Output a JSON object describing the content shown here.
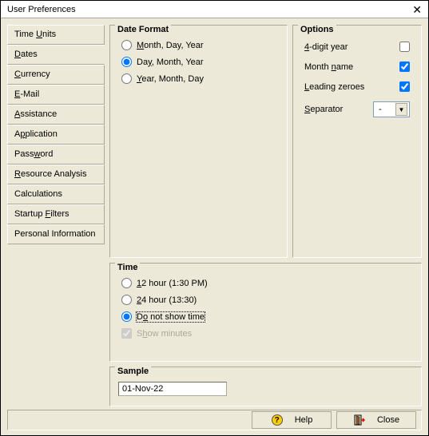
{
  "window": {
    "title": "User Preferences"
  },
  "sidebar": {
    "items": [
      {
        "html": "Time <span class='u'>U</span>nits"
      },
      {
        "html": "<span class='u'>D</span>ates"
      },
      {
        "html": "<span class='u'>C</span>urrency"
      },
      {
        "html": "<span class='u'>E</span>-Mail"
      },
      {
        "html": "<span class='u'>A</span>ssistance"
      },
      {
        "html": "A<span class='u'>p</span>plication"
      },
      {
        "html": "Pass<span class='u'>w</span>ord"
      },
      {
        "html": "<span class='u'>R</span>esource Analysis"
      },
      {
        "html": "Calculations"
      },
      {
        "html": "Startup <span class='u'>F</span>ilters"
      },
      {
        "html": "Personal Information"
      }
    ],
    "active_index": 1
  },
  "dateformat": {
    "title": "Date Format",
    "options": [
      {
        "html": "<span class='u'>M</span>onth, Day, Year",
        "checked": false
      },
      {
        "html": "Da<span class='u'>y</span>, Month, Year",
        "checked": true
      },
      {
        "html": "<span class='u'>Y</span>ear, Month, Day",
        "checked": false
      }
    ]
  },
  "options": {
    "title": "Options",
    "checks": [
      {
        "html": "<span class='u'>4</span>-digit year",
        "checked": false
      },
      {
        "html": "Month <span class='u'>n</span>ame",
        "checked": true
      },
      {
        "html": "<span class='u'>L</span>eading zeroes",
        "checked": true
      }
    ],
    "separator": {
      "html": "<span class='u'>S</span>eparator",
      "value": "-"
    }
  },
  "time": {
    "title": "Time",
    "radios": [
      {
        "html": "<span class='u'>1</span>2 hour (1:30 PM)",
        "checked": false
      },
      {
        "html": "<span class='u'>2</span>4 hour (13:30)",
        "checked": false
      },
      {
        "html": "D<span class='u'>o</span> not show time",
        "checked": true,
        "focused": true
      }
    ],
    "show_minutes": {
      "html": "S<span class='u'>h</span>ow minutes",
      "checked": true,
      "disabled": true
    }
  },
  "sample": {
    "title": "Sample",
    "value": "01-Nov-22"
  },
  "buttons": {
    "help": "Help",
    "close": "Close"
  }
}
